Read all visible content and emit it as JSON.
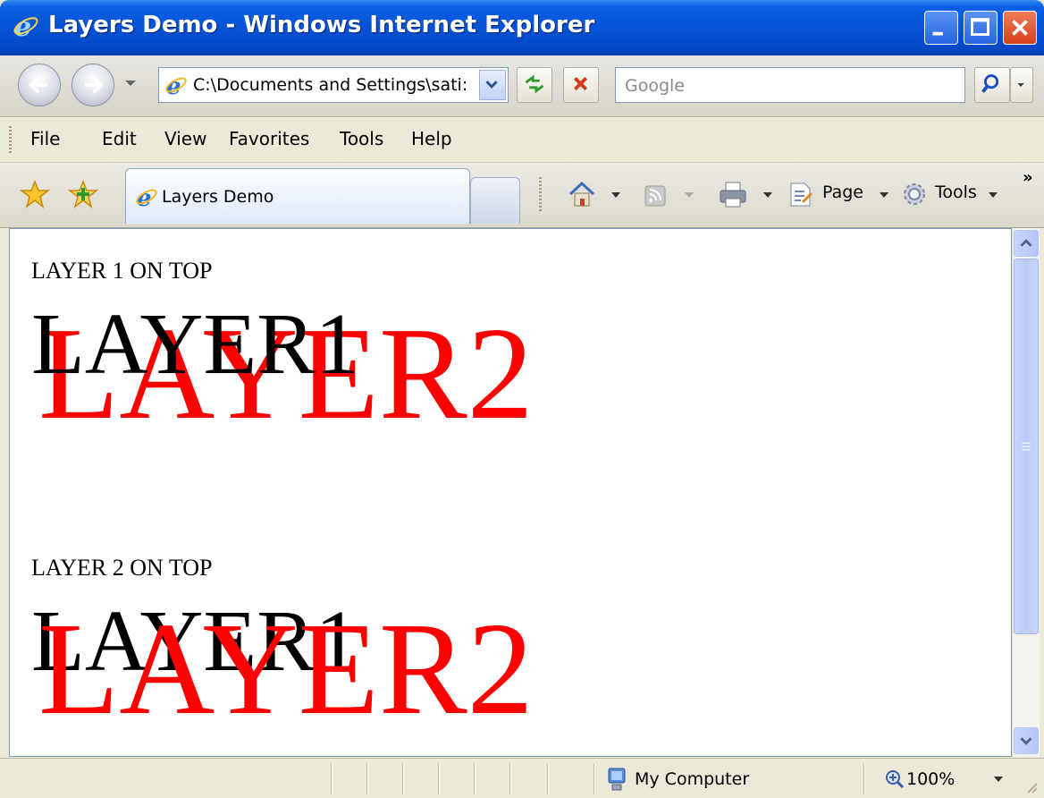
{
  "window": {
    "title": "Layers Demo - Windows Internet Explorer"
  },
  "address": {
    "url": "C:\\Documents and Settings\\sati:"
  },
  "search": {
    "placeholder": "Google"
  },
  "menu": {
    "items": [
      "File",
      "Edit",
      "View",
      "Favorites",
      "Tools",
      "Help"
    ]
  },
  "tab": {
    "label": "Layers Demo"
  },
  "command_bar": {
    "page_label": "Page",
    "tools_label": "Tools"
  },
  "content": {
    "section1": {
      "heading": "LAYER 1 ON TOP",
      "layer1_text": "LAYER1",
      "layer2_text": "LAYER2"
    },
    "section2": {
      "heading": "LAYER 2 ON TOP",
      "layer1_text": "LAYER1",
      "layer2_text": "LAYER2"
    }
  },
  "status": {
    "zone": "My Computer",
    "zoom": "100%"
  },
  "colors": {
    "layer1": "#000000",
    "layer2": "#ff0000",
    "titlebar": "#0653d6"
  },
  "icons": [
    "ie-logo-icon",
    "back-icon",
    "forward-icon",
    "refresh-icon",
    "stop-icon",
    "search-icon",
    "favorites-star-icon",
    "add-favorites-icon",
    "home-icon",
    "rss-feed-icon",
    "print-icon",
    "page-icon",
    "tools-gear-icon",
    "my-computer-icon",
    "zoom-icon"
  ]
}
